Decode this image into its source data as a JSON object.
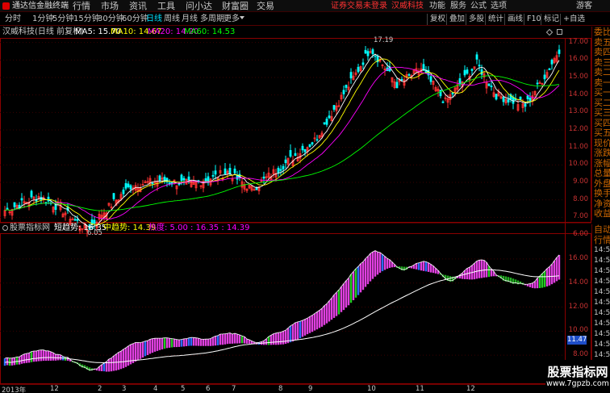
{
  "window": {
    "app_name": "通达信金融终端",
    "menu": [
      "行情",
      "市场",
      "资讯",
      "工具",
      "问小达",
      "财富圈",
      "交易"
    ],
    "notice": "证券交易未登录",
    "stock_name_red": "汉威科技",
    "right_menu": [
      "功能",
      "服务",
      "公式",
      "选项",
      "游客"
    ]
  },
  "toolbar": {
    "periods": [
      "分时",
      "1分钟",
      "5分钟",
      "15分钟",
      "30分钟",
      "60分钟",
      "日线",
      "周线",
      "月线",
      "多周期",
      "更多"
    ],
    "active_period": "日线",
    "right_buttons": [
      "复权",
      "叠加",
      "多股",
      "统计",
      "画线",
      "F10",
      "标记",
      "+自选"
    ]
  },
  "kline_header": {
    "title": "汉威科技(日线 前复权)",
    "ma5": "MA5: 15.70",
    "ma10": "MA10: 14.67",
    "ma20": "MA20: 14.20",
    "ma60": "MA60: 14.53",
    "high_marker": "17.19",
    "low_marker": "6.05"
  },
  "indicator_header": {
    "name": "股票指标网",
    "short": "短趋势: 16.35",
    "mid": "中趋势: 14.39",
    "hot": "热度: 5.00 : 16.35 : 14.39"
  },
  "right_panel": {
    "labels": [
      "委比",
      "卖五",
      "卖四",
      "卖三",
      "卖二",
      "卖一",
      "买一",
      "买二",
      "买三",
      "买四",
      "买五",
      "现价",
      "涨跌",
      "涨幅",
      "总量",
      "外盘",
      "换手",
      "净资",
      "收益"
    ],
    "lower_labels": [
      "自动",
      "行情",
      "14:50",
      "14:50",
      "14:50",
      "14:50",
      "14:50",
      "14:50",
      "14:50",
      "14:50",
      "14:50",
      "14:50",
      "14:50",
      "14:50"
    ]
  },
  "price_axis": [
    "17.00",
    "16.00",
    "15.00",
    "14.00",
    "13.00",
    "12.00",
    "11.00",
    "10.00",
    "9.00",
    "8.00",
    "7.00",
    "6.00"
  ],
  "ind_axis": [
    "16.00",
    "14.00",
    "12.00",
    "10.00",
    "8.00"
  ],
  "ind_current_value": "11.47",
  "x_axis": [
    "2013年",
    "12",
    "2",
    "3",
    "4",
    "5",
    "6",
    "7",
    "8",
    "9",
    "10",
    "11",
    "12"
  ],
  "watermark": {
    "text": "股票指标网",
    "url": "www.7gpzb.com"
  },
  "colors": {
    "up": "#ff3232",
    "down": "#00ffff",
    "ma5": "#ffffff",
    "ma10": "#ffff00",
    "ma20": "#ff00ff",
    "ma60": "#00ff00",
    "axis_text": "#c83232",
    "frame": "#8b0000"
  }
}
